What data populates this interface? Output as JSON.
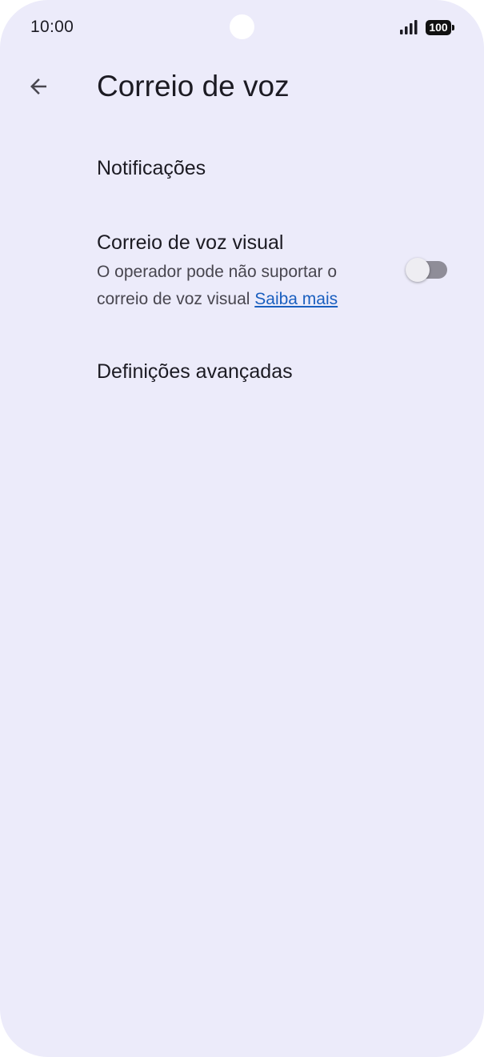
{
  "status_bar": {
    "time": "10:00",
    "battery_level": "100",
    "signal_icon": "signal-bars-icon"
  },
  "header": {
    "back_icon": "arrow-left-icon",
    "title": "Correio de voz"
  },
  "preferences": {
    "notifications": {
      "title": "Notificações"
    },
    "visual_voicemail": {
      "title": "Correio de voz visual",
      "summary": "O operador pode não suportar o correio de voz visual",
      "link_label": "Saiba mais",
      "toggle_on": false
    },
    "advanced": {
      "title": "Definições avançadas"
    }
  },
  "colors": {
    "background": "#ecebfa",
    "link": "#1a5fbf",
    "toggle_track_off": "#8f8d98"
  }
}
